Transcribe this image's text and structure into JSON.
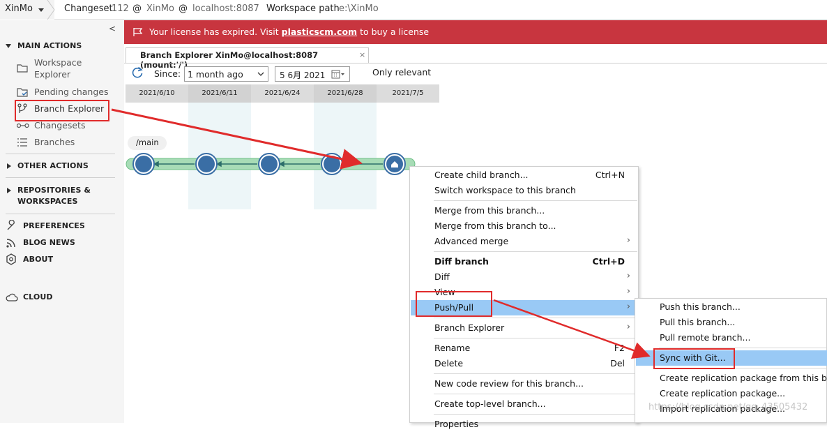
{
  "topbar": {
    "workspace": "XinMo",
    "changeset_label": "Changeset",
    "changeset_number": "112",
    "at1": "@",
    "repo": "XinMo",
    "at2": "@",
    "server": "localhost:8087",
    "workspace_path_label": "Workspace path",
    "workspace_path": "e:\\XinMo"
  },
  "sidebar": {
    "collapse": "<",
    "main_actions": "MAIN ACTIONS",
    "items": [
      {
        "label": "Workspace",
        "label2": "Explorer"
      },
      {
        "label": "Pending changes"
      },
      {
        "label": "Branch Explorer"
      },
      {
        "label": "Changesets"
      },
      {
        "label": "Branches"
      }
    ],
    "other_actions": "OTHER ACTIONS",
    "repos_1": "REPOSITORIES &",
    "repos_2": "WORKSPACES",
    "preferences": "PREFERENCES",
    "blog_news": "BLOG NEWS",
    "about": "ABOUT",
    "cloud": "CLOUD"
  },
  "banner": {
    "prefix": "Your license has expired. Visit ",
    "link": "plasticscm.com",
    "suffix": " to buy a license"
  },
  "tab": {
    "title": "Branch Explorer XinMo@localhost:8087 (mount:'/')",
    "close": "×"
  },
  "toolbar": {
    "since_label": "Since:",
    "since_value": "1 month ago",
    "date_value": "5 6月 2021",
    "only_relevant": "Only relevant"
  },
  "explorer": {
    "dates": [
      "2021/6/10",
      "2021/6/11",
      "2021/6/24",
      "2021/6/28",
      "2021/7/5"
    ],
    "branch_label": "/main"
  },
  "context_menu": {
    "items": [
      {
        "label": "Create child branch...",
        "shortcut": "Ctrl+N"
      },
      {
        "label": "Switch workspace to this branch"
      },
      {
        "label": "Merge from this branch..."
      },
      {
        "label": "Merge from this branch to..."
      },
      {
        "label": "Advanced merge",
        "submenu": "›"
      },
      {
        "label": "Diff branch",
        "shortcut": "Ctrl+D"
      },
      {
        "label": "Diff",
        "submenu": "›"
      },
      {
        "label": "View",
        "submenu": "›"
      },
      {
        "label": "Push/Pull",
        "submenu": "›"
      },
      {
        "label": "Branch Explorer",
        "submenu": "›"
      },
      {
        "label": "Rename",
        "shortcut": "F2"
      },
      {
        "label": "Delete",
        "shortcut": "Del"
      },
      {
        "label": "New code review for this branch..."
      },
      {
        "label": "Create top-level branch..."
      },
      {
        "label": "Properties"
      }
    ]
  },
  "submenu": {
    "items": [
      {
        "label": "Push this branch..."
      },
      {
        "label": "Pull this branch..."
      },
      {
        "label": "Pull remote branch..."
      },
      {
        "label": "Sync with Git..."
      },
      {
        "label": "Create replication package from this branch..."
      },
      {
        "label": "Create replication package..."
      },
      {
        "label": "Import replication package..."
      }
    ]
  },
  "watermark": "https://blog.csdn.net/qq_43505432",
  "colors": {
    "banner": "#c8353f",
    "highlight": "#99c9f5",
    "node": "#3a6ea5",
    "branch_bar": "#a7dcb6",
    "annotation": "#e02b2b"
  }
}
